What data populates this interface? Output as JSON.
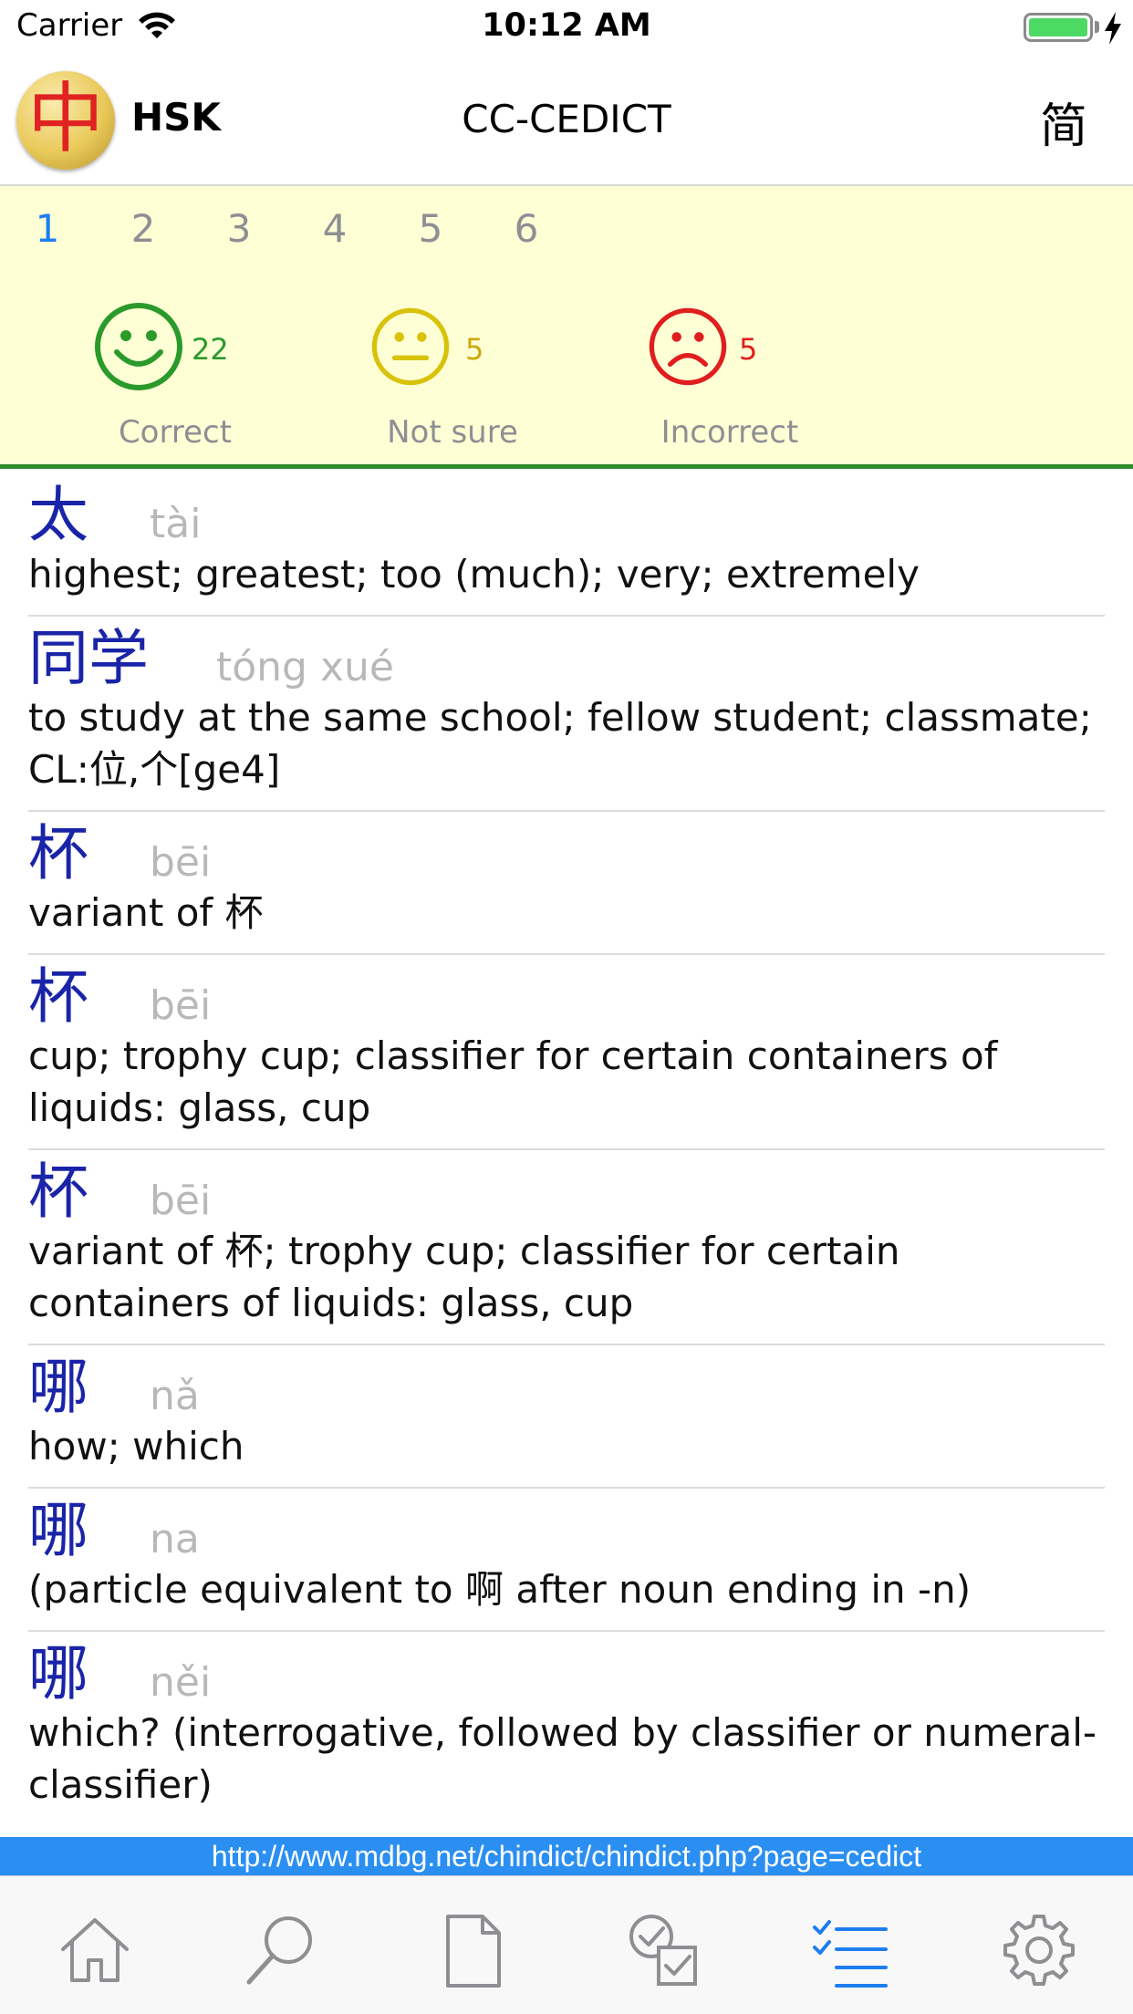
{
  "status_bar": {
    "carrier": "Carrier",
    "time": "10:12 AM",
    "battery_fill": 1.0,
    "battery_color": "#4cd964"
  },
  "nav": {
    "logo_char": "中",
    "hsk_label": "HSK",
    "title": "CC-CEDICT",
    "script_toggle": "简"
  },
  "levels": {
    "items": [
      "1",
      "2",
      "3",
      "4",
      "5",
      "6"
    ],
    "active": "1",
    "active_color": "#1e7ef0"
  },
  "stats": {
    "correct": {
      "count": "22",
      "label": "Correct",
      "color": "#2a9a2a",
      "icon": "smiley-face-icon"
    },
    "not_sure": {
      "count": "5",
      "label": "Not sure",
      "color": "#d8c20a",
      "icon": "neutral-face-icon"
    },
    "incorrect": {
      "count": "5",
      "label": "Incorrect",
      "color": "#e01e1e",
      "icon": "sad-face-icon"
    }
  },
  "entries": [
    {
      "hanzi": "太",
      "pinyin": "tài",
      "definition": "highest; greatest; too (much); very; extremely"
    },
    {
      "hanzi": "同学",
      "pinyin": "tóng xué",
      "definition": "to study at the same school; fellow student; classmate; CL:位,个[ge4]"
    },
    {
      "hanzi": "杯",
      "pinyin": "bēi",
      "definition": "variant of 杯"
    },
    {
      "hanzi": "杯",
      "pinyin": "bēi",
      "definition": "cup; trophy cup; classifier for certain containers of liquids: glass, cup"
    },
    {
      "hanzi": "杯",
      "pinyin": "bēi",
      "definition": "variant of 杯; trophy cup; classifier for certain containers of liquids: glass, cup"
    },
    {
      "hanzi": "哪",
      "pinyin": "nǎ",
      "definition": "how; which"
    },
    {
      "hanzi": "哪",
      "pinyin": "na",
      "definition": "(particle equivalent to 啊 after noun ending in -n)"
    },
    {
      "hanzi": "哪",
      "pinyin": "něi",
      "definition": "which? (interrogative, followed by classifier or numeral-classifier)"
    }
  ],
  "source_url": "http://www.mdbg.net/chindict/chindict.php?page=cedict",
  "tab_bar": {
    "tabs": [
      {
        "icon": "home-icon"
      },
      {
        "icon": "search-icon"
      },
      {
        "icon": "document-icon"
      },
      {
        "icon": "quiz-check-icon"
      },
      {
        "icon": "checklist-icon",
        "active": true
      },
      {
        "icon": "gear-icon"
      }
    ],
    "active_color": "#1e7ef0",
    "inactive_color": "#8e8e93"
  }
}
